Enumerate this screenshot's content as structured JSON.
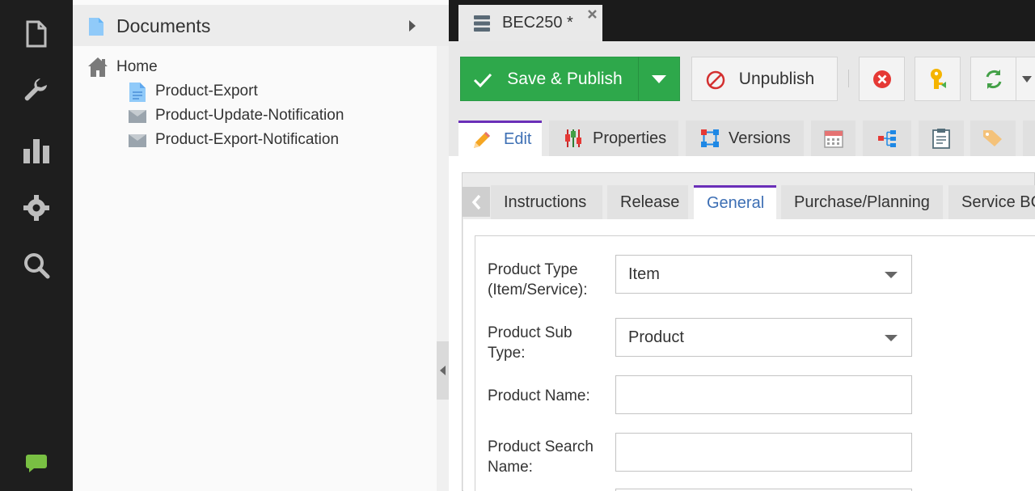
{
  "tree": {
    "header_title": "Documents",
    "root_label": "Home",
    "items": [
      {
        "label": "Product-Export",
        "icon": "document-icon"
      },
      {
        "label": "Product-Update-Notification",
        "icon": "email-icon"
      },
      {
        "label": "Product-Export-Notification",
        "icon": "email-icon"
      }
    ]
  },
  "document_tab": {
    "label": "BEC250 *"
  },
  "toolbar": {
    "save_label": "Save & Publish",
    "unpublish_label": "Unpublish"
  },
  "editor_tabs": {
    "edit": "Edit",
    "properties": "Properties",
    "versions": "Versions"
  },
  "sub_tabs": [
    "Instructions",
    "Release",
    "General",
    "Purchase/Planning",
    "Service BC"
  ],
  "form": {
    "product_type_label_1": "Product Type",
    "product_type_label_2": "(Item/Service):",
    "product_type_value": "Item",
    "product_sub_type_label_1": "Product Sub",
    "product_sub_type_label_2": "Type:",
    "product_sub_type_value": "Product",
    "product_name_label": "Product Name:",
    "product_name_value": "",
    "product_search_name_label_1": "Product Search",
    "product_search_name_label_2": "Name:",
    "product_search_name_value": ""
  },
  "colors": {
    "accent_green": "#2ea84b",
    "active_tab_purple": "#6a2fb8",
    "link_blue": "#3d6fb4",
    "chat_green": "#79c043"
  }
}
